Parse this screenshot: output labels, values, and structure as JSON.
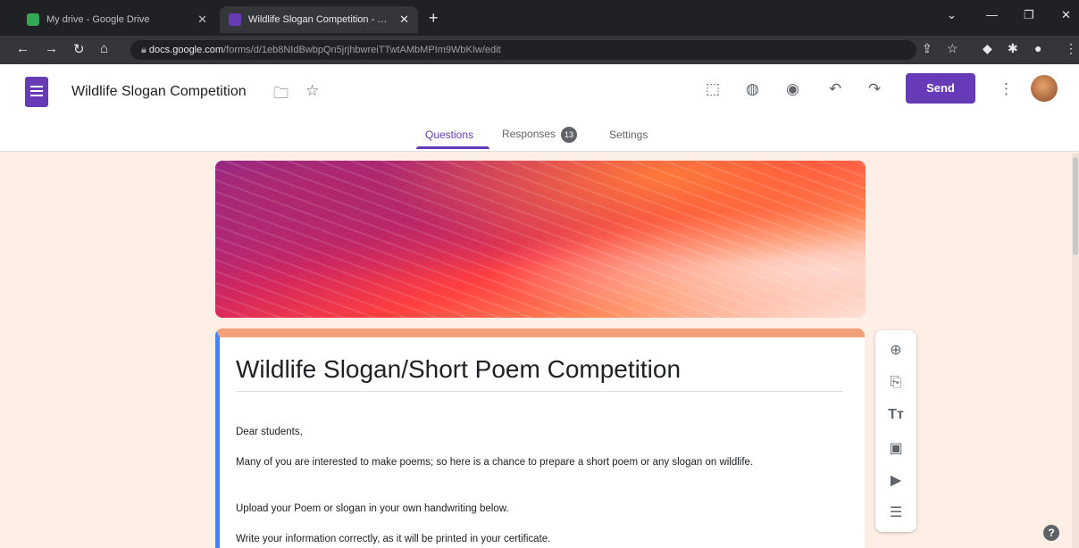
{
  "browser": {
    "tabs": [
      {
        "title": "My drive - Google Drive",
        "active": false,
        "favicon_color": "#34a853"
      },
      {
        "title": "Wildlife Slogan Competition - Google Forms",
        "active": true,
        "favicon_color": "#673ab7"
      }
    ],
    "url_host": "docs.google.com",
    "url_path": "/forms/d/1eb8NIdBwbpQn5jrjhbwreiTTwtAMbMPIm9WbKIw/edit",
    "new_tab_icon": "plus-icon"
  },
  "form_header": {
    "title": "Wildlife Slogan Competition",
    "send_label": "Send",
    "accent_color": "#673ab7"
  },
  "form_tabs": {
    "questions": "Questions",
    "responses": "Responses",
    "responses_count": "13",
    "settings": "Settings"
  },
  "card": {
    "title": "Wildlife Slogan/Short Poem Competition",
    "paragraphs": [
      "Dear students,",
      "Many of you are interested to make poems; so here is a chance to prepare a short poem or any slogan on wildlife.",
      "Upload your Poem or slogan in your own handwriting below.",
      "Write your information correctly, as it will be printed in your certificate."
    ]
  },
  "colors": {
    "page_bg": "#fdeee6",
    "card_top_border": "#f4a079",
    "card_left_border": "#4285f4"
  }
}
